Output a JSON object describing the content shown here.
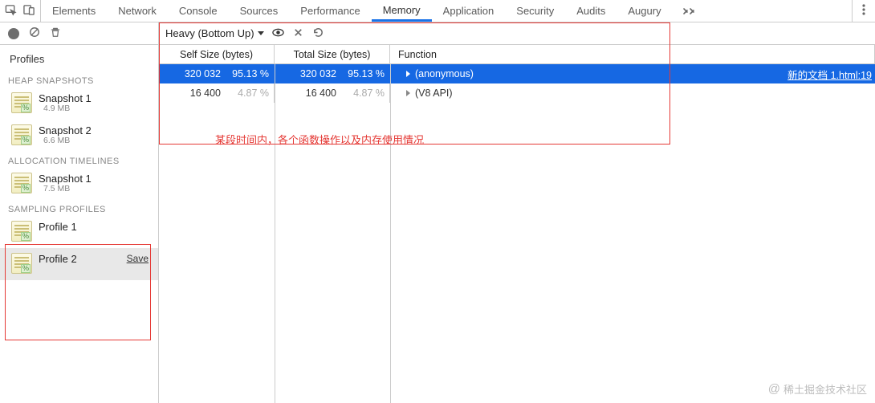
{
  "tabs": {
    "items": [
      "Elements",
      "Network",
      "Console",
      "Sources",
      "Performance",
      "Memory",
      "Application",
      "Security",
      "Audits",
      "Augury"
    ],
    "active_index": 5
  },
  "toolbar": {
    "view_label": "Heavy (Bottom Up)"
  },
  "sidebar": {
    "title": "Profiles",
    "groups": [
      {
        "label": "HEAP SNAPSHOTS",
        "items": [
          {
            "name": "Snapshot 1",
            "sub": "4.9 MB"
          },
          {
            "name": "Snapshot 2",
            "sub": "6.6 MB"
          }
        ]
      },
      {
        "label": "ALLOCATION TIMELINES",
        "items": [
          {
            "name": "Snapshot 1",
            "sub": "7.5 MB"
          }
        ]
      },
      {
        "label": "SAMPLING PROFILES",
        "items": [
          {
            "name": "Profile 1",
            "sub": ""
          },
          {
            "name": "Profile 2",
            "sub": "",
            "selected": true,
            "save": "Save"
          }
        ]
      }
    ]
  },
  "table": {
    "columns": {
      "self": "Self Size (bytes)",
      "total": "Total Size (bytes)",
      "fn": "Function"
    },
    "rows": [
      {
        "self_size": "320 032",
        "self_pct": "95.13 %",
        "total_size": "320 032",
        "total_pct": "95.13 %",
        "fn": "(anonymous)",
        "source": "新的文档 1.html:19",
        "selected": true
      },
      {
        "self_size": "16 400",
        "self_pct": "4.87 %",
        "total_size": "16 400",
        "total_pct": "4.87 %",
        "fn": "(V8 API)",
        "source": "",
        "selected": false
      }
    ]
  },
  "annotation": "某段时间内，各个函数操作以及内存使用情况",
  "watermark": "稀土掘金技术社区"
}
